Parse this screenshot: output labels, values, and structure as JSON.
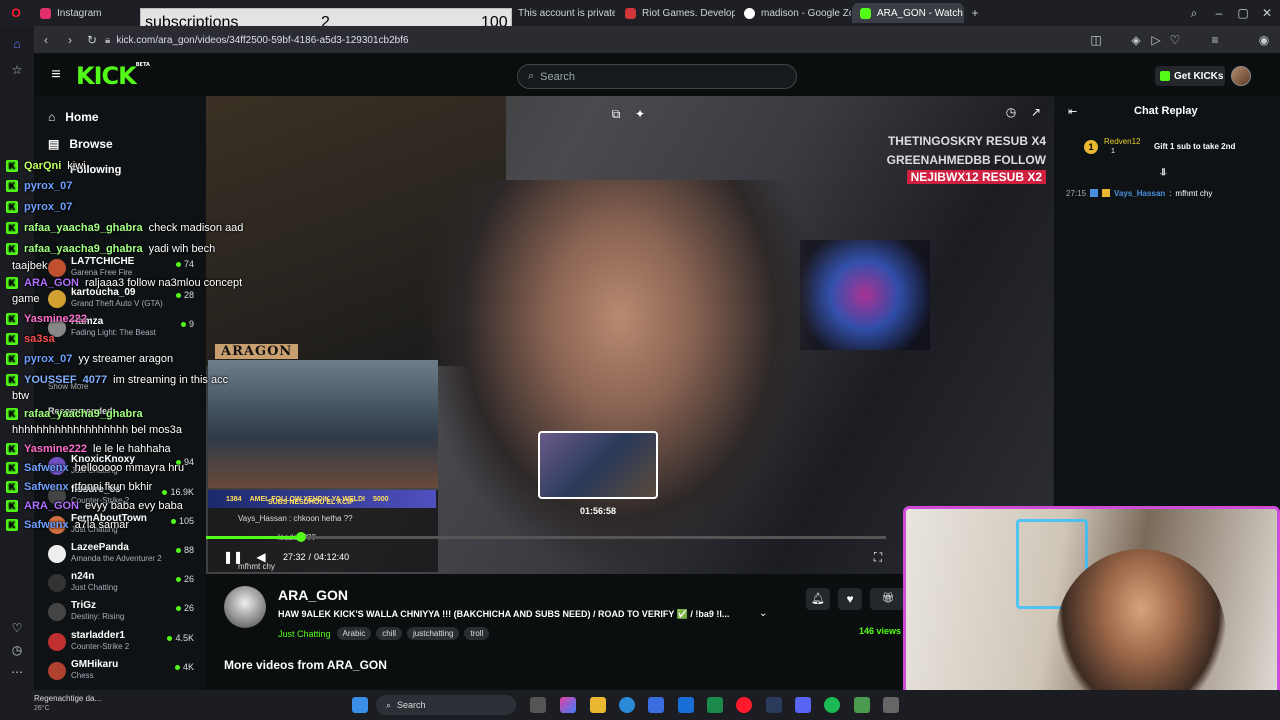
{
  "overlay_counter": {
    "label": "subscriptions",
    "current": "2",
    "goal": "100"
  },
  "browser": {
    "tabs": [
      {
        "label": "Instagram",
        "color": "#e1306c"
      },
      {
        "label": "This account is private. Fo...",
        "color": "#d62976"
      },
      {
        "label": "Riot Games. Developer of...",
        "color": "#d13639"
      },
      {
        "label": "madison - Google Zoeken",
        "color": "#4285f4"
      },
      {
        "label": "ARA_GON - Watch th...",
        "color": "#53fc18"
      }
    ],
    "url": "kick.com/ara_gon/videos/34ff2500-59bf-4186-a5d3-129301cb2bf6",
    "new_tab": "+"
  },
  "header": {
    "logo": "KICK",
    "logo_beta": "BETA",
    "search_placeholder": "Search",
    "get_kicks": "Get KICKs"
  },
  "sidebar": {
    "home": "Home",
    "browse": "Browse",
    "following": "Following",
    "recommended": "Recommended",
    "show_more": "Show More",
    "channels": [
      {
        "name": "LA7TCHICHE",
        "game": "Garena Free Fire",
        "viewers": "74",
        "color": "#c05030"
      },
      {
        "name": "kartoucha_09",
        "game": "Grand Theft Auto V (GTA)",
        "viewers": "28",
        "color": "#d0a030"
      },
      {
        "name": "Hamza",
        "game": "Fading Light: The Beast",
        "viewers": "9",
        "color": "#888"
      },
      {
        "name": "KnoxicKnoxy",
        "game": "Just Chatting",
        "viewers": "94",
        "color": "#7050c0"
      },
      {
        "name": "fissure_cs",
        "game": "Counter-Strike 2",
        "viewers": "16.9K",
        "color": "#444"
      },
      {
        "name": "FernAboutTown",
        "game": "Just Chatting",
        "viewers": "105",
        "color": "#d07040"
      },
      {
        "name": "LazeePanda",
        "game": "Amanda the Adventurer 2",
        "viewers": "88",
        "color": "#eee"
      },
      {
        "name": "n24n",
        "game": "Just Chatting",
        "viewers": "26",
        "color": "#333"
      },
      {
        "name": "TriGz",
        "game": "Destiny: Rising",
        "viewers": "26",
        "color": "#444"
      },
      {
        "name": "starladder1",
        "game": "Counter-Strike 2",
        "viewers": "4.5K",
        "color": "#c03030"
      },
      {
        "name": "GMHikaru",
        "game": "Chess",
        "viewers": "4K",
        "color": "#b04030"
      }
    ]
  },
  "overlay_chat": [
    {
      "user": "QarQni",
      "msg": "kiwi",
      "ucolor": "#c0ff60"
    },
    {
      "user": "pyrox_07",
      "msg": "",
      "ucolor": "#6ea0ff"
    },
    {
      "user": "pyrox_07",
      "msg": "",
      "ucolor": "#6ea0ff"
    },
    {
      "user": "rafaa_yaacha9_ghabra",
      "msg": "check madison aad",
      "ucolor": "#a0ff80"
    },
    {
      "user": "rafaa_yaacha9_ghabra",
      "msg": "yadi wih bech",
      "ucolor": "#a0ff80"
    },
    {
      "user": "",
      "msg": "taajbek",
      "ucolor": "#fff"
    },
    {
      "user": "ARA_GON",
      "msg": "raljaaa3 follow na3mlou concept",
      "ucolor": "#b070ff"
    },
    {
      "user": "",
      "msg": "game",
      "ucolor": "#fff"
    },
    {
      "user": "Yasmine222",
      "msg": "",
      "ucolor": "#ff70d0"
    },
    {
      "user": "sa3sa",
      "msg": "",
      "ucolor": "#ff5050"
    },
    {
      "user": "pyrox_07",
      "msg": "yy streamer aragon",
      "ucolor": "#6ea0ff"
    },
    {
      "user": "YOUSSEF_4077",
      "msg": "im streaming in this acc",
      "ucolor": "#80b0ff"
    },
    {
      "user": "",
      "msg": "btw",
      "ucolor": "#fff"
    },
    {
      "user": "rafaa_yaacha9_ghabra",
      "msg": "",
      "ucolor": "#a0ff80"
    },
    {
      "user": "",
      "msg": "hhhhhhhhhhhhhhhhhhh bel mos3a",
      "ucolor": "#fff"
    },
    {
      "user": "Yasmine222",
      "msg": "le le le hahhaha",
      "ucolor": "#ff70d0"
    },
    {
      "user": "Safwenx",
      "msg": "hellooooo mmayra hru",
      "ucolor": "#70a0ff"
    },
    {
      "user": "Safwenx",
      "msg": "tfonni fkun bkhir",
      "ucolor": "#70a0ff"
    },
    {
      "user": "ARA_GON",
      "msg": "evyy baba evy baba",
      "ucolor": "#b070ff"
    },
    {
      "user": "Safwenx",
      "msg": "a7la samar",
      "ucolor": "#70a0ff"
    }
  ],
  "video": {
    "banner_lines": [
      "THETINGOSKRY RESUB X4",
      "GREENAHMEDBB FOLLOW",
      "NEJIBWX12 RESUB X2"
    ],
    "overlay_tag": "ARAGON",
    "preview_time": "01:56:58",
    "current_time": "27:32",
    "total_time": "04:12:40",
    "progress_fraction": 0.14,
    "event_text": "AMEL FOLLOW YEHDIK YA WELDI",
    "event_num": "5000",
    "event_num2": "1384",
    "event_text2": "SUBS NESDHOU EL KCIP",
    "mini_chat": [
      "Vays_Hassan : chkoon hetha ??",
      "leader ???",
      "mfhmt chy"
    ]
  },
  "stream_info": {
    "channel": "ARA_GON",
    "title": "HAW 9ALEK KICK'S WALLA CHNIYYA !!! (BAKCHICHA AND SUBS NEED) / ROAD TO VERIFY ✅ / !ba9 !l...",
    "category": "Just Chatting",
    "tags": [
      "Arabic",
      "chill",
      "justchatting",
      "troll"
    ],
    "views": "146 views",
    "more_videos": "More videos from ARA_GON"
  },
  "chat_replay": {
    "title": "Chat Replay",
    "pinned_user": "Redven12",
    "pinned_count": "1",
    "pinned_msg": "Gift 1 sub to take 2nd",
    "messages": [
      {
        "time": "27:15",
        "user": "Vays_Hassan",
        "msg": "mfhmt chy"
      }
    ]
  },
  "taskbar": {
    "weather_title": "Regenachtige da...",
    "weather_temp": "26°C",
    "search": "Search"
  },
  "colors": {
    "accent": "#53fc18",
    "webcam_border": "#d04bd8"
  }
}
